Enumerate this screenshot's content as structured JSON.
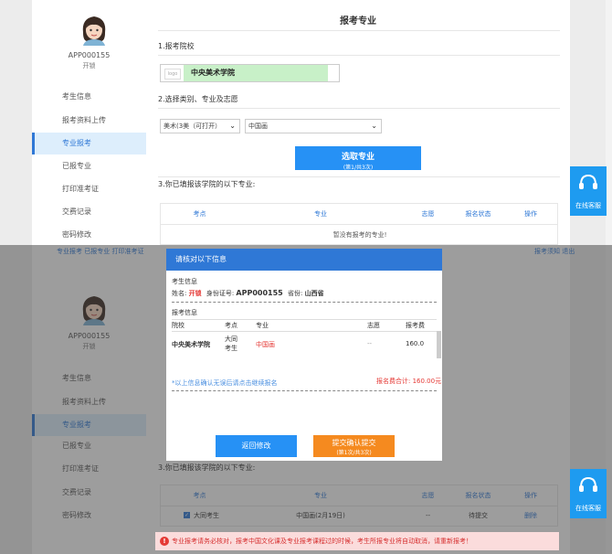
{
  "account": {
    "id": "APP000155",
    "name": "开锁"
  },
  "sidebar": {
    "items": [
      {
        "label": "考生信息"
      },
      {
        "label": "报考资料上传"
      },
      {
        "label": "专业报考"
      },
      {
        "label": "已报专业"
      },
      {
        "label": "打印准考证"
      },
      {
        "label": "交费记录"
      },
      {
        "label": "密码修改"
      }
    ]
  },
  "main": {
    "title": "报考专业",
    "step1": "1.报考院校",
    "school": {
      "thumb": "logo",
      "name": "中央美术学院"
    },
    "step2": "2.选择类别、专业及志愿",
    "category_select": "美术(3美（可打开）",
    "major_select": "中国画",
    "select_button": {
      "label": "选取专业",
      "sub": "(第1/共3次)"
    },
    "step3": "3.你已填报该学院的以下专业:",
    "table_headers": [
      "考点",
      "专业",
      "志愿",
      "报名状态",
      "操作"
    ],
    "empty_text": "暂没有报考的专业!"
  },
  "chat": {
    "label": "在线客服"
  },
  "panel2": {
    "top_strip_left": "专业报考 已报专业 打印准考证",
    "top_strip_right": "报考须知 退出",
    "row": {
      "exam_site": "大同考生",
      "major": "中国画(2月19日)",
      "wish": "--",
      "status": "待提交",
      "action": "删除"
    },
    "notice": "专业报考请务必核对，报考中国文化课及专业报考课程过的时候，考生所报专业将自动取消，请重新报考！"
  },
  "modal": {
    "header": "请核对以下信息",
    "candidate_section": "考生信息",
    "name_label": "姓名:",
    "name_value": "开锁",
    "id_label": "身份证号:",
    "id_value": "APP000155",
    "province_label": "省份:",
    "province_value": "山西省",
    "report_section": "报考信息",
    "col_headers": [
      "院校",
      "考点",
      "专业",
      "志愿",
      "报考费"
    ],
    "row": {
      "school": "中央美术学院",
      "site": "大同考生",
      "major": "中国画",
      "wish": "--",
      "fee": "160.0"
    },
    "link": "*以上信息确认无误后请点击继续报名",
    "total_label": "报名费合计:",
    "total_value": "160.00元",
    "back_button": "返回修改",
    "confirm_button": "提交确认提交",
    "confirm_sub": "(第1次/共3次)"
  },
  "colors": {
    "primary": "#2f78d6",
    "button_blue": "#2691f5",
    "confirm_orange": "#f58a1f",
    "highlight_green": "#c8f0c8",
    "danger": "#e53935"
  }
}
